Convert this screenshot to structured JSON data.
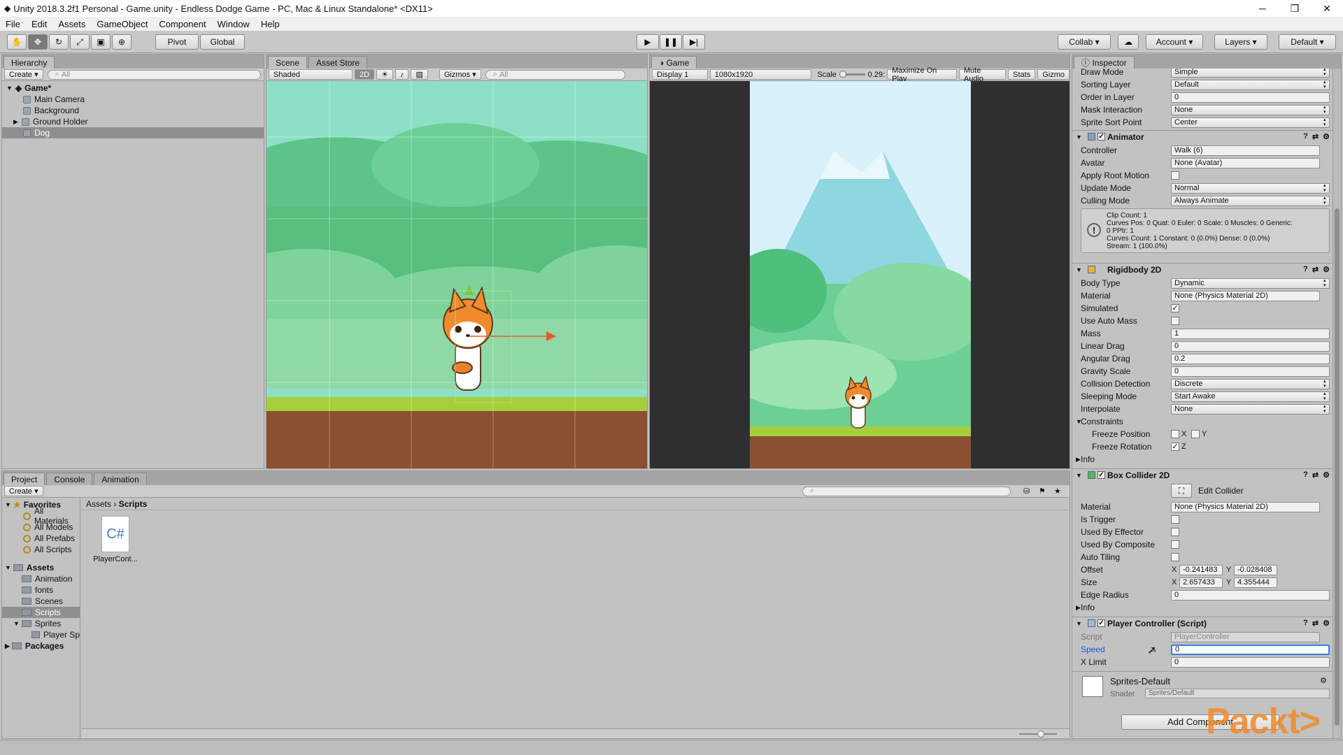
{
  "titlebar": {
    "title": "Unity 2018.3.2f1 Personal - Game.unity - Endless Dodge Game - PC, Mac & Linux Standalone* <DX11>",
    "min": "─",
    "max": "❐",
    "close": "✕"
  },
  "menu": [
    "File",
    "Edit",
    "Assets",
    "GameObject",
    "Component",
    "Window",
    "Help"
  ],
  "toolbar": {
    "pivot": "Pivot",
    "global": "Global",
    "collab": "Collab ▾",
    "account": "Account",
    "layers": "Layers",
    "layout": "Default"
  },
  "hierarchy": {
    "tab": "Hierarchy",
    "create": "Create ▾",
    "search_placeholder": "All",
    "scene": "Game*",
    "items": [
      "Main Camera",
      "Background",
      "Ground Holder",
      "Dog"
    ]
  },
  "scene": {
    "tab_scene": "Scene",
    "tab_store": "Asset Store",
    "shading": "Shaded",
    "mode2d": "2D",
    "gizmos": "Gizmos ▾",
    "search_placeholder": "All"
  },
  "game": {
    "tab": "Game",
    "display": "Display 1",
    "resolution": "1080x1920",
    "scale_label": "Scale",
    "scale_value": "0.29:",
    "maximize": "Maximize On Play",
    "mute": "Mute Audio",
    "stats": "Stats",
    "gizmos": "Gizmo"
  },
  "project": {
    "tab_project": "Project",
    "tab_console": "Console",
    "tab_anim": "Animation",
    "create": "Create ▾",
    "breadcrumb_root": "Assets",
    "breadcrumb_sep": "›",
    "breadcrumb_cur": "Scripts",
    "favorites_label": "Favorites",
    "favorites": [
      "All Materials",
      "All Models",
      "All Prefabs",
      "All Scripts"
    ],
    "assets_label": "Assets",
    "assets": [
      "Animation",
      "fonts",
      "Scenes",
      "Scripts",
      "Sprites"
    ],
    "sprites_child": "Player Sp",
    "packages": "Packages",
    "file_icon": "C#",
    "file_name": "PlayerCont..."
  },
  "inspector": {
    "tab": "Inspector",
    "sprite_renderer": [
      [
        "Draw Mode",
        "Simple"
      ],
      [
        "Sorting Layer",
        "Default"
      ],
      [
        "Order in Layer",
        "0"
      ],
      [
        "Mask Interaction",
        "None"
      ],
      [
        "Sprite Sort Point",
        "Center"
      ]
    ],
    "animator": {
      "name": "Animator",
      "controller": [
        "Controller",
        "Walk (6)"
      ],
      "avatar": [
        "Avatar",
        "None (Avatar)"
      ],
      "apply_root": "Apply Root Motion",
      "update": [
        "Update Mode",
        "Normal"
      ],
      "culling": [
        "Culling Mode",
        "Always Animate"
      ],
      "info": [
        "Clip Count: 1",
        "Curves Pos: 0 Quat: 0 Euler: 0 Scale: 0 Muscles: 0 Generic:",
        "0 PPtr: 1",
        "Curves Count: 1 Constant: 0 (0.0%) Dense: 0 (0.0%)",
        "Stream: 1 (100.0%)"
      ]
    },
    "rigidbody": {
      "name": "Rigidbody 2D",
      "body_type": [
        "Body Type",
        "Dynamic"
      ],
      "material": [
        "Material",
        "None (Physics Material 2D)"
      ],
      "simulated": "Simulated",
      "auto_mass": "Use Auto Mass",
      "mass": [
        "Mass",
        "1"
      ],
      "linear": [
        "Linear Drag",
        "0"
      ],
      "angular": [
        "Angular Drag",
        "0.2"
      ],
      "gravity": [
        "Gravity Scale",
        "0"
      ],
      "collision": [
        "Collision Detection",
        "Discrete"
      ],
      "sleeping": [
        "Sleeping Mode",
        "Start Awake"
      ],
      "interpolate": [
        "Interpolate",
        "None"
      ],
      "constraints": "Constraints",
      "freeze_pos": "Freeze Position",
      "freeze_rot": "Freeze Rotation",
      "x": "X",
      "y": "Y",
      "z": "Z",
      "info": "Info"
    },
    "box": {
      "name": "Box Collider 2D",
      "edit": "Edit Collider",
      "material": [
        "Material",
        "None (Physics Material 2D)"
      ],
      "trigger": "Is Trigger",
      "effector": "Used By Effector",
      "composite": "Used By Composite",
      "tiling": "Auto Tiling",
      "offset": "Offset",
      "offset_x": "-0.241483",
      "offset_y": "-0.028408",
      "size": "Size",
      "size_x": "2.657433",
      "size_y": "4.355444",
      "edge": [
        "Edge Radius",
        "0"
      ],
      "info": "Info"
    },
    "player": {
      "name": "Player Controller (Script)",
      "script": [
        "Script",
        "PlayerController"
      ],
      "speed": [
        "Speed",
        "0"
      ],
      "xlimit": [
        "X Limit",
        "0"
      ]
    },
    "material": {
      "name": "Sprites-Default",
      "shader_label": "Shader",
      "shader": "Sprites/Default"
    },
    "add_component": "Add Component"
  },
  "watermark": "Packt>"
}
